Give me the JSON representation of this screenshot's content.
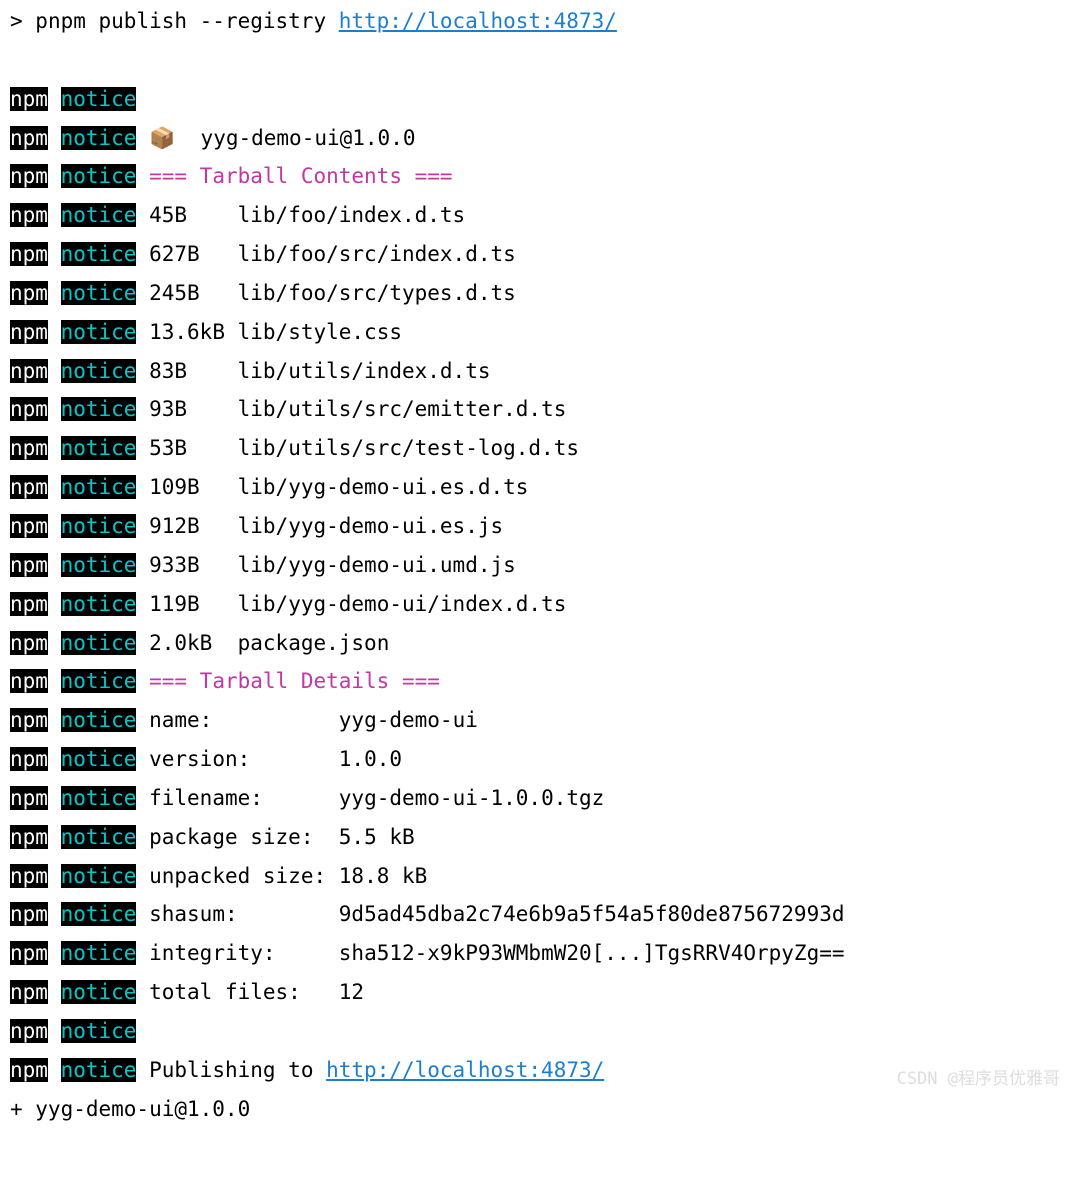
{
  "prompt": "> ",
  "command": "pnpm publish --registry ",
  "registry_url": "http://localhost:4873/",
  "npm_label": "npm",
  "notice_label": "notice",
  "package_emoji": "📦",
  "package_line": "  yyg-demo-ui@1.0.0",
  "tarball_contents_header": "=== Tarball Contents ===",
  "tarball_details_header": "=== Tarball Details ===",
  "contents": [
    {
      "size": "45B   ",
      "file": "lib/foo/index.d.ts"
    },
    {
      "size": "627B  ",
      "file": "lib/foo/src/index.d.ts"
    },
    {
      "size": "245B  ",
      "file": "lib/foo/src/types.d.ts"
    },
    {
      "size": "13.6kB",
      "file": "lib/style.css"
    },
    {
      "size": "83B   ",
      "file": "lib/utils/index.d.ts"
    },
    {
      "size": "93B   ",
      "file": "lib/utils/src/emitter.d.ts"
    },
    {
      "size": "53B   ",
      "file": "lib/utils/src/test-log.d.ts"
    },
    {
      "size": "109B  ",
      "file": "lib/yyg-demo-ui.es.d.ts"
    },
    {
      "size": "912B  ",
      "file": "lib/yyg-demo-ui.es.js"
    },
    {
      "size": "933B  ",
      "file": "lib/yyg-demo-ui.umd.js"
    },
    {
      "size": "119B  ",
      "file": "lib/yyg-demo-ui/index.d.ts"
    },
    {
      "size": "2.0kB ",
      "file": "package.json"
    }
  ],
  "details": [
    {
      "label": "name:         ",
      "value": "yyg-demo-ui"
    },
    {
      "label": "version:      ",
      "value": "1.0.0"
    },
    {
      "label": "filename:     ",
      "value": "yyg-demo-ui-1.0.0.tgz"
    },
    {
      "label": "package size: ",
      "value": "5.5 kB"
    },
    {
      "label": "unpacked size:",
      "value": "18.8 kB"
    },
    {
      "label": "shasum:       ",
      "value": "9d5ad45dba2c74e6b9a5f54a5f80de875672993d"
    },
    {
      "label": "integrity:    ",
      "value": "sha512-x9kP93WMbmW20[...]TgsRRV4OrpyZg=="
    },
    {
      "label": "total files:  ",
      "value": "12"
    }
  ],
  "publishing_prefix": "Publishing to ",
  "publishing_url": "http://localhost:4873/",
  "final_line": "+ yyg-demo-ui@1.0.0",
  "watermark": "CSDN @程序员优雅哥"
}
